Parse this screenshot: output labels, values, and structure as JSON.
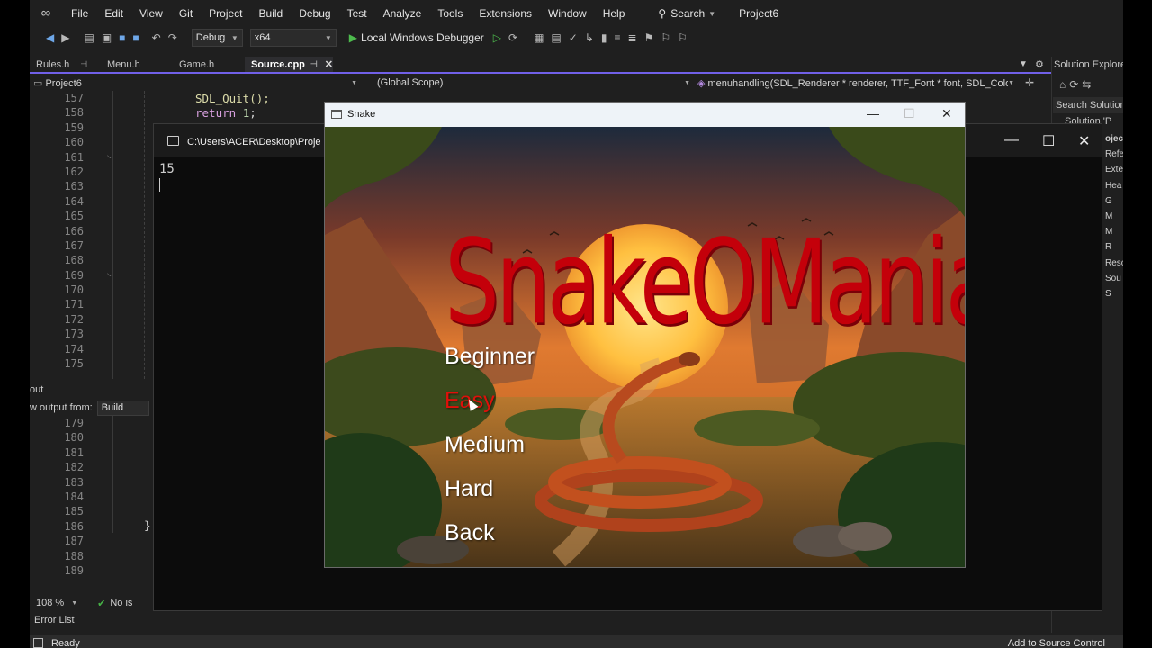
{
  "menubar": {
    "items": [
      "File",
      "Edit",
      "View",
      "Git",
      "Project",
      "Build",
      "Debug",
      "Test",
      "Analyze",
      "Tools",
      "Extensions",
      "Window",
      "Help"
    ],
    "search_label": "Search",
    "project_title": "Project6"
  },
  "toolbar": {
    "config": "Debug",
    "platform": "x64",
    "debugger_label": "Local Windows Debugger"
  },
  "tabs": [
    {
      "label": "Rules.h",
      "pinned": true
    },
    {
      "label": "Menu.h"
    },
    {
      "label": "Game.h"
    },
    {
      "label": "Source.cpp",
      "active": true
    }
  ],
  "navbar": {
    "project": "Project6",
    "scope": "(Global Scope)",
    "function": "menuhandling(SDL_Renderer * renderer, TTF_Font * font, SDL_Color col"
  },
  "editor": {
    "line_numbers_top": [
      "157",
      "158",
      "159",
      "160",
      "161",
      "162",
      "163",
      "164",
      "165",
      "166",
      "167",
      "168",
      "169",
      "170",
      "171",
      "172",
      "173",
      "174",
      "175"
    ],
    "line_numbers_bottom": [
      "179",
      "180",
      "181",
      "182",
      "183",
      "184",
      "185",
      "186",
      "187",
      "188",
      "189"
    ],
    "code": {
      "line157": "SDL_Quit();",
      "line158_kw": "return",
      "line158_num": "1",
      "line158_end": ";",
      "line186": "}"
    }
  },
  "output": {
    "header": "out",
    "show_from_label": "w output from:",
    "source": "Build"
  },
  "status": {
    "zoom": "108 %",
    "issues": "No is",
    "error_list": "Error List",
    "ready": "Ready",
    "source_control": "Add to Source Control"
  },
  "solution_explorer": {
    "title": "Solution Explore",
    "search": "Search Solution",
    "root": "Solution 'P",
    "items": [
      "oject",
      "Refe",
      "Exte",
      "Hea",
      "G",
      "M",
      "M",
      "R",
      "Reso",
      "Sou",
      "S"
    ]
  },
  "console": {
    "title": "C:\\Users\\ACER\\Desktop\\Proje",
    "output_text": "15"
  },
  "snake_window": {
    "title": "Snake",
    "logo": "SnakeOMania",
    "menu": [
      "Beginner",
      "Easy",
      "Medium",
      "Hard",
      "Back"
    ],
    "selected": "Easy"
  }
}
